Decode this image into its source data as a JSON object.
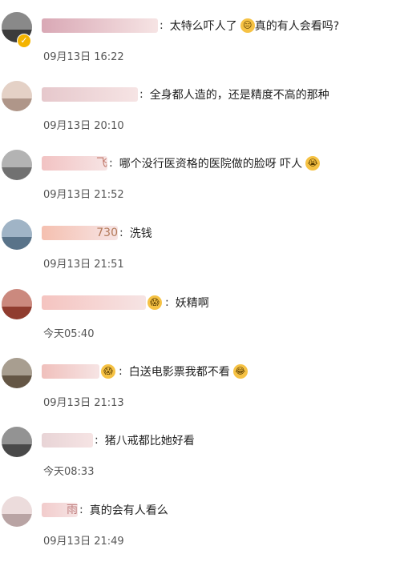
{
  "comments": [
    {
      "name_tail": "",
      "separator": ":",
      "text": "太特么吓人了",
      "emoji": "😑",
      "text2": "真的有人会看吗?",
      "time": "09月13日 16:22",
      "avatar_color": "#4a4a4a",
      "name_color": "#d9a8b5",
      "name_width": 145
    },
    {
      "name_tail": "",
      "separator": ":",
      "text": "全身都人造的，还是精度不高的那种",
      "emoji": "",
      "text2": "",
      "time": "09月13日 20:10",
      "avatar_color": "#d6b8a8",
      "name_color": "#e6c8cc",
      "name_width": 120
    },
    {
      "name_tail": "飞",
      "separator": ":",
      "text": "哪个没行医资格的医院做的脸呀 吓人",
      "emoji": "😭",
      "text2": "",
      "time": "09月13日 21:52",
      "avatar_color": "#8a8a8a",
      "name_color": "#f2c3c3",
      "name_width": 82
    },
    {
      "name_tail": "730",
      "separator": ":",
      "text": "洗钱",
      "emoji": "",
      "text2": "",
      "time": "09月13日 21:51",
      "avatar_color": "#6d8da8",
      "name_color": "#f5c0b0",
      "name_width": 95
    },
    {
      "name_tail": "",
      "separator": ":",
      "text": "妖精啊",
      "emoji": "😱",
      "text2": "",
      "time": "今天05:40",
      "avatar_color": "#b04a3a",
      "name_color": "#f5c4c0",
      "name_width": 130
    },
    {
      "name_tail": "",
      "separator": ":",
      "text": "白送电影票我都不看",
      "emoji": "😂",
      "text2": "",
      "time": "09月13日 21:13",
      "avatar_color": "#7a6a55",
      "name_color": "#f0c0bc",
      "name_width": 72
    },
    {
      "name_tail": "",
      "separator": ":",
      "text": "猪八戒都比她好看",
      "emoji": "",
      "text2": "",
      "time": "今天08:33",
      "avatar_color": "#5a5a5a",
      "name_color": "#e8d4d6",
      "name_width": 64
    },
    {
      "name_tail": "雨",
      "separator": ":",
      "text": "真的会有人看么",
      "emoji": "",
      "text2": "",
      "time": "09月13日 21:49",
      "avatar_color": "#e2c9c9",
      "name_color": "#f2cccc",
      "name_width": 45
    }
  ]
}
